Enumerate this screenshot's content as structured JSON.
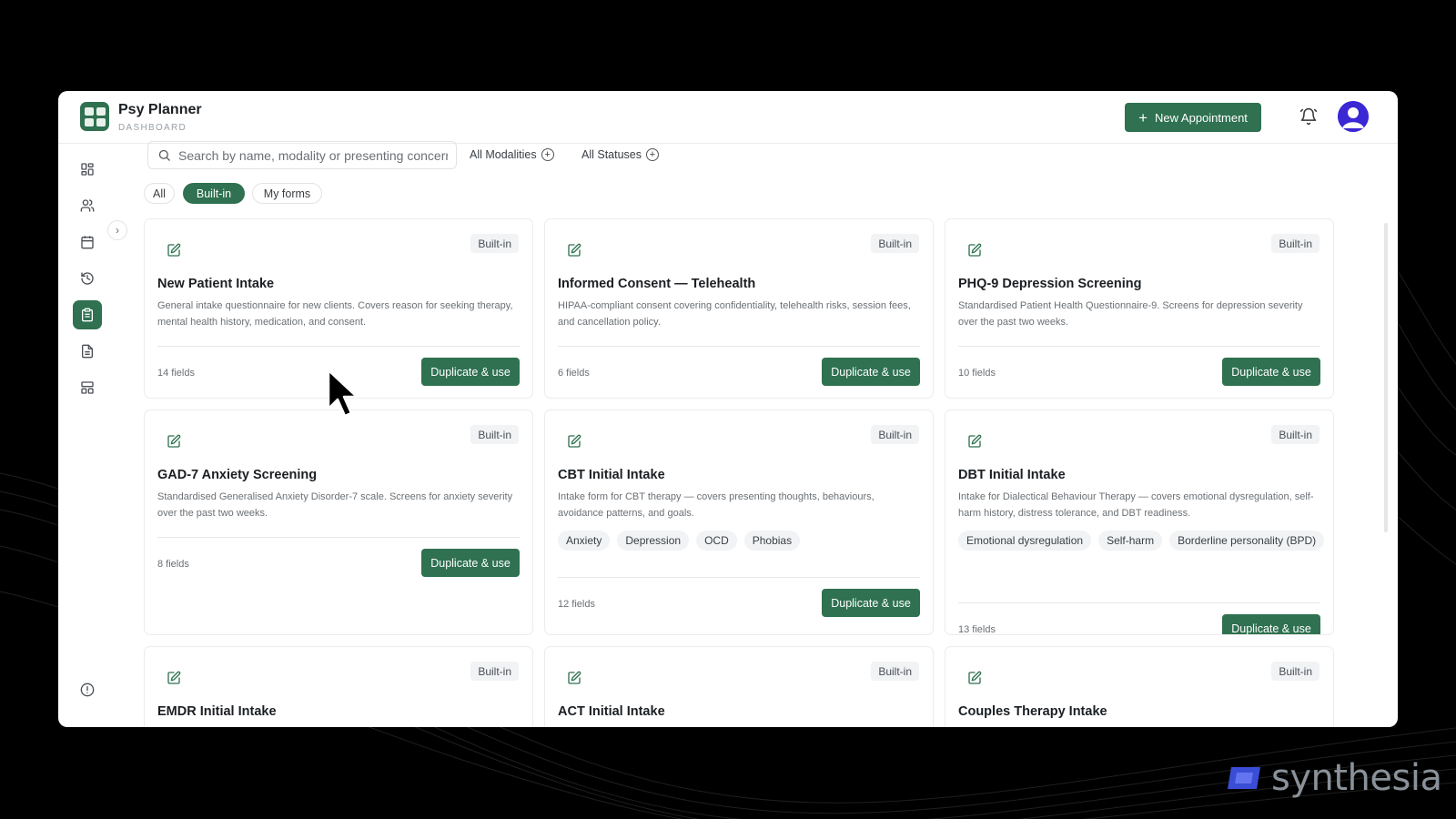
{
  "app": {
    "name": "Psy Planner",
    "section": "DASHBOARD",
    "new_appointment_label": "New Appointment",
    "accent_color": "#2f7150"
  },
  "sidebar": {
    "items": [
      {
        "name": "dashboard",
        "icon": "grid-icon"
      },
      {
        "name": "clients",
        "icon": "users-icon"
      },
      {
        "name": "calendar",
        "icon": "calendar-icon"
      },
      {
        "name": "history",
        "icon": "history-icon"
      },
      {
        "name": "forms",
        "icon": "clipboard-icon",
        "active": true
      },
      {
        "name": "documents",
        "icon": "document-icon"
      },
      {
        "name": "templates",
        "icon": "layout-icon"
      }
    ],
    "bottom_icon": "info-icon"
  },
  "toolbar": {
    "search_placeholder": "Search by name, modality or presenting concern",
    "modalities_filter": "All Modalities",
    "statuses_filter": "All Statuses"
  },
  "tabs": [
    {
      "label": "All",
      "active": false
    },
    {
      "label": "Built-in",
      "active": true
    },
    {
      "label": "My forms",
      "active": false
    }
  ],
  "cards": [
    {
      "badge": "Built-in",
      "title": "New Patient Intake",
      "description": "General intake questionnaire for new clients. Covers reason for seeking therapy, mental health history, medication, and consent.",
      "tags": [],
      "fields": "14 fields",
      "action": "Duplicate & use"
    },
    {
      "badge": "Built-in",
      "title": "Informed Consent — Telehealth",
      "description": "HIPAA-compliant consent covering confidentiality, telehealth risks, session fees, and cancellation policy.",
      "tags": [],
      "fields": "6 fields",
      "action": "Duplicate & use"
    },
    {
      "badge": "Built-in",
      "title": "PHQ-9 Depression Screening",
      "description": "Standardised Patient Health Questionnaire-9. Screens for depression severity over the past two weeks.",
      "tags": [],
      "fields": "10 fields",
      "action": "Duplicate & use"
    },
    {
      "badge": "Built-in",
      "title": "GAD-7 Anxiety Screening",
      "description": "Standardised Generalised Anxiety Disorder-7 scale. Screens for anxiety severity over the past two weeks.",
      "tags": [],
      "fields": "8 fields",
      "action": "Duplicate & use"
    },
    {
      "badge": "Built-in",
      "title": "CBT Initial Intake",
      "description": "Intake form for CBT therapy — covers presenting thoughts, behaviours, avoidance patterns, and goals.",
      "tags": [
        "Anxiety",
        "Depression",
        "OCD",
        "Phobias"
      ],
      "fields": "12 fields",
      "action": "Duplicate & use"
    },
    {
      "badge": "Built-in",
      "title": "DBT Initial Intake",
      "description": "Intake for Dialectical Behaviour Therapy — covers emotional dysregulation, self-harm history, distress tolerance, and DBT readiness.",
      "tags": [
        "Emotional dysregulation",
        "Self-harm",
        "Borderline personality (BPD)"
      ],
      "fields": "13 fields",
      "action": "Duplicate & use"
    },
    {
      "badge": "Built-in",
      "title": "EMDR Initial Intake",
      "description": "",
      "tags": [],
      "fields": "",
      "action": ""
    },
    {
      "badge": "Built-in",
      "title": "ACT Initial Intake",
      "description": "",
      "tags": [],
      "fields": "",
      "action": ""
    },
    {
      "badge": "Built-in",
      "title": "Couples Therapy Intake",
      "description": "",
      "tags": [],
      "fields": "",
      "action": ""
    }
  ],
  "watermark": "synthesia"
}
